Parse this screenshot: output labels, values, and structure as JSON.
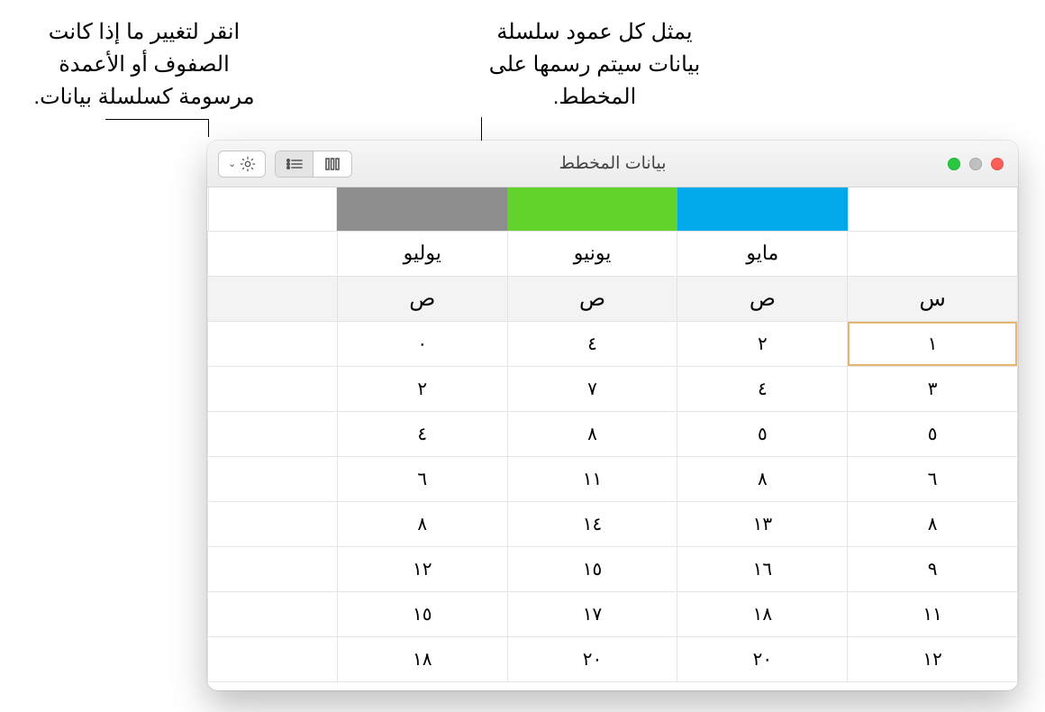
{
  "callouts": {
    "left_text": "انقر لتغيير ما إذا كانت الصفوف أو الأعمدة مرسومة كسلسلة بيانات.",
    "right_text": "يمثل كل عمود سلسلة بيانات سيتم رسمها على المخطط."
  },
  "window": {
    "title": "بيانات المخطط"
  },
  "series_colors": {
    "blue": "#02a9ea",
    "green": "#62d22c",
    "gray": "#8e8e8e"
  },
  "months": {
    "c1": "مايو",
    "c2": "يونيو",
    "c3": "يوليو"
  },
  "axis_labels": {
    "x": "س",
    "y": "ص"
  },
  "rows": [
    {
      "x": "١",
      "c1": "٢",
      "c2": "٤",
      "c3": "٠"
    },
    {
      "x": "٣",
      "c1": "٤",
      "c2": "٧",
      "c3": "٢"
    },
    {
      "x": "٥",
      "c1": "٥",
      "c2": "٨",
      "c3": "٤"
    },
    {
      "x": "٦",
      "c1": "٨",
      "c2": "١١",
      "c3": "٦"
    },
    {
      "x": "٨",
      "c1": "١٣",
      "c2": "١٤",
      "c3": "٨"
    },
    {
      "x": "٩",
      "c1": "١٦",
      "c2": "١٥",
      "c3": "١٢"
    },
    {
      "x": "١١",
      "c1": "١٨",
      "c2": "١٧",
      "c3": "١٥"
    },
    {
      "x": "١٢",
      "c1": "٢٠",
      "c2": "٢٠",
      "c3": "١٨"
    }
  ],
  "chart_data": {
    "type": "table",
    "title": "بيانات المخطط",
    "x_column": "س",
    "y_columns": [
      "مايو",
      "يونيو",
      "يوليو"
    ],
    "x": [
      1,
      3,
      5,
      6,
      8,
      9,
      11,
      12
    ],
    "series": [
      {
        "name": "مايو",
        "color": "#02a9ea",
        "values": [
          2,
          4,
          5,
          8,
          13,
          16,
          18,
          20
        ]
      },
      {
        "name": "يونيو",
        "color": "#62d22c",
        "values": [
          4,
          7,
          8,
          11,
          14,
          15,
          17,
          20
        ]
      },
      {
        "name": "يوليو",
        "color": "#8e8e8e",
        "values": [
          0,
          2,
          4,
          6,
          8,
          12,
          15,
          18
        ]
      }
    ]
  }
}
